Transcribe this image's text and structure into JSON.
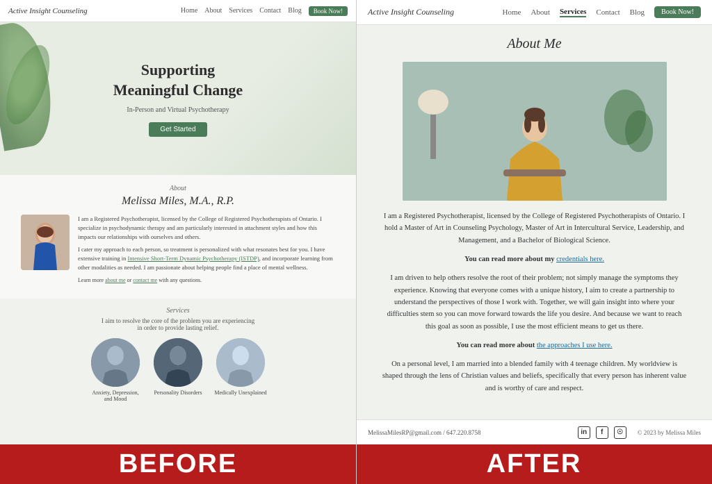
{
  "left": {
    "nav": {
      "logo": "Active Insight Counseling",
      "links": [
        "Home",
        "About",
        "Services",
        "Contact",
        "Blog"
      ],
      "book_label": "Book Now!"
    },
    "hero": {
      "heading_line1": "Supporting",
      "heading_line2": "Meaningful Change",
      "subheading": "In-Person and Virtual Psychotherapy",
      "cta_label": "Get Started"
    },
    "about": {
      "section_label": "About",
      "name": "Melissa Miles, M.A., R.P.",
      "para1": "I am a Registered Psychotherapist, licensed by the College of Registered Psychotherapists of Ontario. I specialize in psychodynamic therapy and am particularly interested in attachment styles and how this impacts our relationships with ourselves and others.",
      "para2": "I cater my approach to each person, so treatment is personalized with what resonates best for you. I have extensive training in Intensive Short-Term Dynamic Psychotherapy (ISTDP), and incorporate learning from other modalities as needed. I am passionate about helping people find a place of mental wellness.",
      "learn_more_prefix": "Learn more ",
      "about_link": "about me",
      "or": " or ",
      "contact_link": "contact me",
      "learn_more_suffix": " with any questions."
    },
    "services": {
      "section_label": "Services",
      "description": "I aim to resolve the core of the problem you are experiencing\nin order to provide lasting relief.",
      "cards": [
        {
          "label": "Anxiety, Depression, and Mood"
        },
        {
          "label": "Personality Disorders"
        },
        {
          "label": "Medically Unexplained"
        }
      ]
    }
  },
  "right": {
    "nav": {
      "logo": "Active Insight Counseling",
      "links": [
        "Home",
        "About",
        "Services",
        "Contact",
        "Blog"
      ],
      "active_link": "Services",
      "book_label": "Book Now!"
    },
    "about": {
      "heading": "About Me",
      "para1": "I am a Registered Psychotherapist, licensed by the College of Registered Psychotherapists of Ontario. I hold a Master of Art in Counseling Psychology, Master of Art in Intercultural Service, Leadership, and Management, and a Bachelor of Biological Science.",
      "credentials_prefix": "You can read more about my ",
      "credentials_link": "credentials here.",
      "para2": "I am driven to help others resolve the root of their problem; not simply manage the symptoms they experience. Knowing that everyone comes with a unique history, I aim to create a partnership to understand the perspectives of those I work with. Together, we will gain insight into where your difficulties stem so you can move forward towards the life you desire. And because we want to reach this goal as soon as possible, I use the most efficient means to get us there.",
      "approaches_prefix": "You can read more about ",
      "approaches_link": "the approaches I use here.",
      "para3": "On a personal level, I am married into a blended family with 4 teenage children. My worldview is shaped through the lens of Christian values and beliefs, specifically that every person has inherent value and is worthy of care and respect."
    },
    "footer": {
      "contact": "MelissaMilesRP@gmail.com / 647.220.8758",
      "copyright": "© 2023 by Melissa Miles",
      "social": [
        "in",
        "f",
        "📷"
      ]
    }
  },
  "ba_bar": {
    "before": "BEFORE",
    "after": "AFTER"
  }
}
